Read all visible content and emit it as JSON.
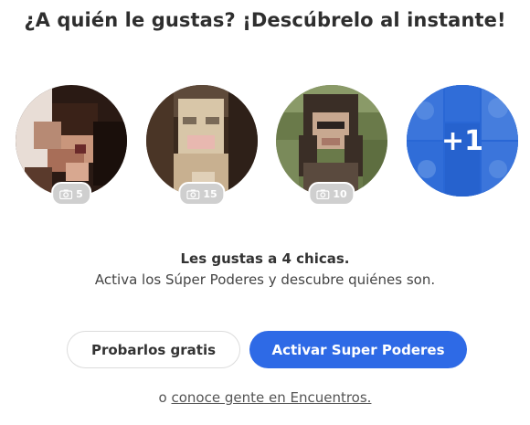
{
  "header": {
    "title": "¿A quién le gustas? ¡Descúbrelo al instante!"
  },
  "avatars": [
    {
      "photo_count": "5"
    },
    {
      "photo_count": "15"
    },
    {
      "photo_count": "10"
    }
  ],
  "more": {
    "label": "+1"
  },
  "message": {
    "line1": "Les gustas a 4 chicas.",
    "line2": "Activa los Súper Poderes y descubre quiénes son."
  },
  "buttons": {
    "free_label": "Probarlos gratis",
    "super_label": "Activar Super Poderes"
  },
  "footer": {
    "prefix": "o",
    "link_label": "conoce gente en Encuentros."
  },
  "colors": {
    "accent": "#2e6ae6",
    "badge": "#cfcfcf"
  },
  "icons": {
    "badge_icon": "camera-icon"
  }
}
